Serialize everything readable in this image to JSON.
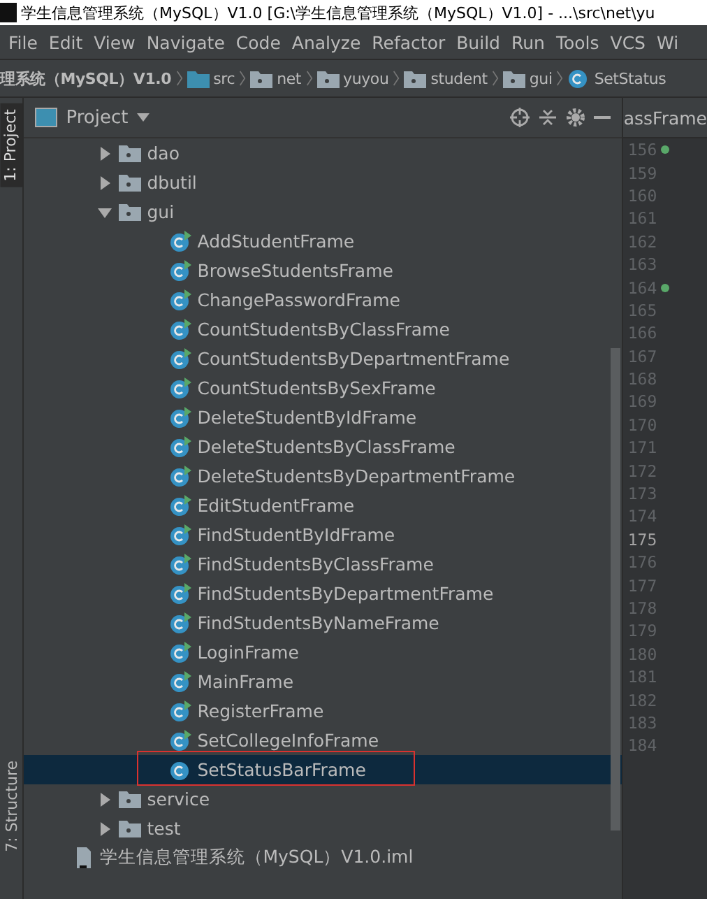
{
  "window": {
    "title": "学生信息管理系统（MySQL）V1.0 [G:\\学生信息管理系统（MySQL）V1.0] - ...\\src\\net\\yu"
  },
  "menu": [
    "File",
    "Edit",
    "View",
    "Navigate",
    "Code",
    "Analyze",
    "Refactor",
    "Build",
    "Run",
    "Tools",
    "VCS",
    "Wi"
  ],
  "breadcrumb": [
    {
      "label": "理系统（MySQL）V1.0",
      "kind": "project"
    },
    {
      "label": "src",
      "kind": "source"
    },
    {
      "label": "net",
      "kind": "package"
    },
    {
      "label": "yuyou",
      "kind": "package"
    },
    {
      "label": "student",
      "kind": "package"
    },
    {
      "label": "gui",
      "kind": "package"
    },
    {
      "label": "SetStatus",
      "kind": "class"
    }
  ],
  "side_tabs": [
    {
      "label": "1: Project",
      "selected": true
    },
    {
      "label": "7: Structure",
      "selected": false
    }
  ],
  "project_panel": {
    "title": "Project",
    "tree": [
      {
        "label": "dao",
        "kind": "package",
        "expanded": false
      },
      {
        "label": "dbutil",
        "kind": "package",
        "expanded": false
      },
      {
        "label": "gui",
        "kind": "package",
        "expanded": true,
        "children": [
          {
            "label": "AddStudentFrame",
            "kind": "runnable-class",
            "selected": false
          },
          {
            "label": "BrowseStudentsFrame",
            "kind": "runnable-class",
            "selected": false
          },
          {
            "label": "ChangePasswordFrame",
            "kind": "runnable-class",
            "selected": false
          },
          {
            "label": "CountStudentsByClassFrame",
            "kind": "runnable-class",
            "selected": false
          },
          {
            "label": "CountStudentsByDepartmentFrame",
            "kind": "runnable-class",
            "selected": false
          },
          {
            "label": "CountStudentsBySexFrame",
            "kind": "runnable-class",
            "selected": false
          },
          {
            "label": "DeleteStudentByIdFrame",
            "kind": "runnable-class",
            "selected": false
          },
          {
            "label": "DeleteStudentsByClassFrame",
            "kind": "runnable-class",
            "selected": false
          },
          {
            "label": "DeleteStudentsByDepartmentFrame",
            "kind": "runnable-class",
            "selected": false
          },
          {
            "label": "EditStudentFrame",
            "kind": "runnable-class",
            "selected": false
          },
          {
            "label": "FindStudentByIdFrame",
            "kind": "runnable-class",
            "selected": false
          },
          {
            "label": "FindStudentsByClassFrame",
            "kind": "runnable-class",
            "selected": false
          },
          {
            "label": "FindStudentsByDepartmentFrame",
            "kind": "runnable-class",
            "selected": false
          },
          {
            "label": "FindStudentsByNameFrame",
            "kind": "runnable-class",
            "selected": false
          },
          {
            "label": "LoginFrame",
            "kind": "runnable-class",
            "selected": false
          },
          {
            "label": "MainFrame",
            "kind": "runnable-class",
            "selected": false
          },
          {
            "label": "RegisterFrame",
            "kind": "runnable-class",
            "selected": false
          },
          {
            "label": "SetCollegeInfoFrame",
            "kind": "runnable-class",
            "selected": false
          },
          {
            "label": "SetStatusBarFrame",
            "kind": "class",
            "selected": true
          }
        ]
      },
      {
        "label": "service",
        "kind": "package",
        "expanded": false
      },
      {
        "label": "test",
        "kind": "package",
        "expanded": false
      },
      {
        "label": "学生信息管理系统（MySQL）V1.0.iml",
        "kind": "file"
      }
    ]
  },
  "editor": {
    "tab": "assFrame",
    "lines": [
      {
        "number": "156",
        "current": false,
        "marker": true
      },
      {
        "number": "159",
        "current": false,
        "marker": false
      },
      {
        "number": "160",
        "current": false,
        "marker": false
      },
      {
        "number": "161",
        "current": false,
        "marker": false
      },
      {
        "number": "162",
        "current": false,
        "marker": false
      },
      {
        "number": "163",
        "current": false,
        "marker": false
      },
      {
        "number": "164",
        "current": false,
        "marker": true
      },
      {
        "number": "165",
        "current": false,
        "marker": false
      },
      {
        "number": "166",
        "current": false,
        "marker": false
      },
      {
        "number": "167",
        "current": false,
        "marker": false
      },
      {
        "number": "168",
        "current": false,
        "marker": false
      },
      {
        "number": "169",
        "current": false,
        "marker": false
      },
      {
        "number": "170",
        "current": false,
        "marker": false
      },
      {
        "number": "171",
        "current": false,
        "marker": false
      },
      {
        "number": "172",
        "current": false,
        "marker": false
      },
      {
        "number": "173",
        "current": false,
        "marker": false
      },
      {
        "number": "174",
        "current": false,
        "marker": false
      },
      {
        "number": "175",
        "current": true,
        "marker": false
      },
      {
        "number": "176",
        "current": false,
        "marker": false
      },
      {
        "number": "177",
        "current": false,
        "marker": false
      },
      {
        "number": "178",
        "current": false,
        "marker": false
      },
      {
        "number": "179",
        "current": false,
        "marker": false
      },
      {
        "number": "180",
        "current": false,
        "marker": false
      },
      {
        "number": "181",
        "current": false,
        "marker": false
      },
      {
        "number": "182",
        "current": false,
        "marker": false
      },
      {
        "number": "183",
        "current": false,
        "marker": false
      },
      {
        "number": "184",
        "current": false,
        "marker": false
      }
    ]
  }
}
